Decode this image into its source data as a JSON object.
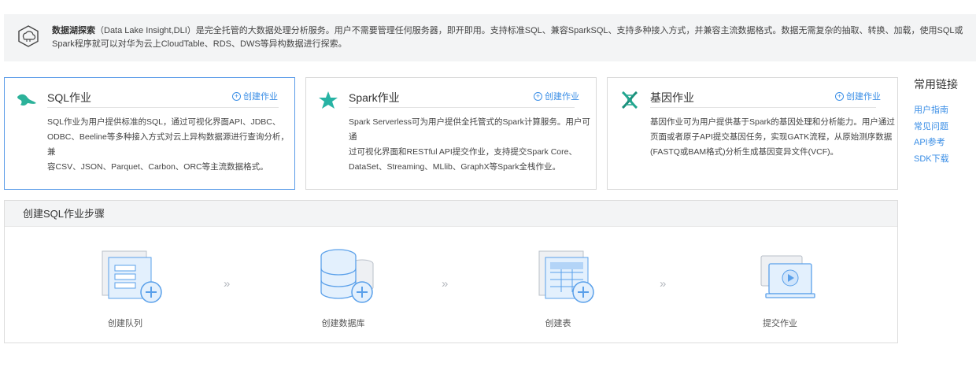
{
  "intro": {
    "bold": "数据湖探索",
    "text": "（Data Lake Insight,DLI）是完全托管的大数据处理分析服务。用户不需要管理任何服务器，即开即用。支持标准SQL、兼容SparkSQL、支持多种接入方式，并兼容主流数据格式。数据无需复杂的抽取、转换、加载，使用SQL或Spark程序就可以对华为云上CloudTable、RDS、DWS等异构数据进行探索。"
  },
  "cards": [
    {
      "title": "SQL作业",
      "link": "创建作业",
      "desc": [
        "SQL作业为用户提供标准的SQL，通过可视化界面API、JDBC、",
        "ODBC、Beeline等多种接入方式对云上异构数据源进行查询分析，兼",
        "容CSV、JSON、Parquet、Carbon、ORC等主流数据格式。"
      ]
    },
    {
      "title": "Spark作业",
      "link": "创建作业",
      "desc": [
        "Spark Serverless可为用户提供全托管式的Spark计算服务。用户可通",
        "过可视化界面和RESTful API提交作业，支持提交Spark Core、",
        "DataSet、Streaming、MLlib、GraphX等Spark全栈作业。"
      ]
    },
    {
      "title": "基因作业",
      "link": "创建作业",
      "desc": [
        "基因作业可为用户提供基于Spark的基因处理和分析能力。用户通过",
        "页面或者原子API提交基因任务，实现GATK流程，从原始测序数据",
        "(FASTQ或BAM格式)分析生成基因变异文件(VCF)。"
      ]
    }
  ],
  "links": {
    "title": "常用链接",
    "items": [
      "用户指南",
      "常见问题",
      "API参考",
      "SDK下载"
    ]
  },
  "steps": {
    "title": "创建SQL作业步骤",
    "arrow": "»",
    "items": [
      "创建队列",
      "创建数据库",
      "创建表",
      "提交作业"
    ]
  },
  "colors": {
    "accent": "#3a8ee6",
    "sql_icon": "#2cb29a",
    "spark_icon": "#27b3a4",
    "gene_icon": "#22a68f"
  }
}
